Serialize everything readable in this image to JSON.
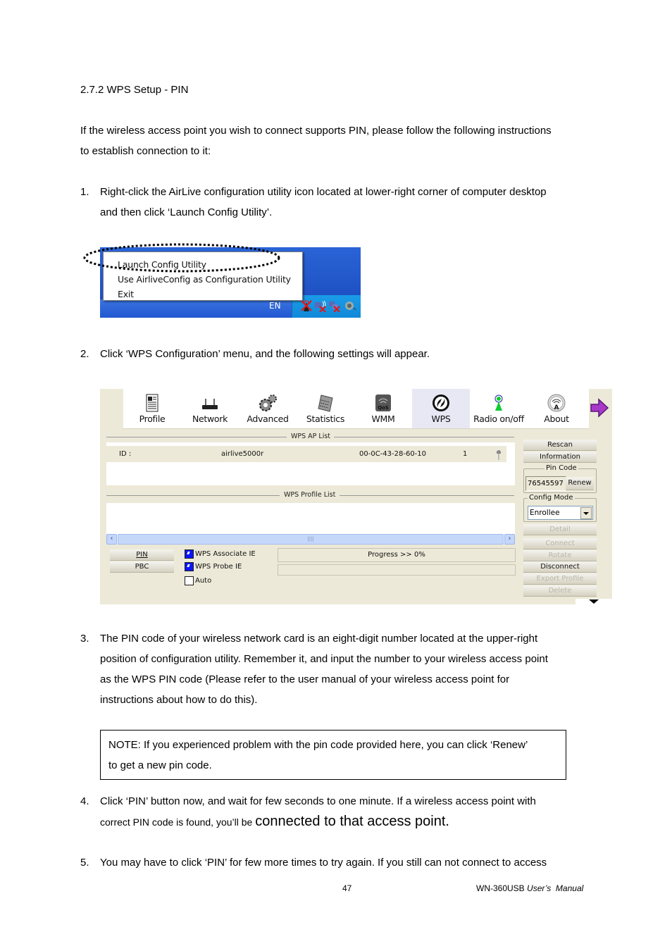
{
  "section_title": "2.7.2 WPS Setup - PIN",
  "intro": {
    "line1": "If the wireless access point you wish to connect supports PIN, please follow the following instructions",
    "line2": "to establish connection to it:"
  },
  "steps": [
    {
      "num": "1.",
      "lines": [
        "Right-click the AirLive configuration utility icon located at lower-right corner of computer desktop",
        "and then click ‘Launch Config Utility’."
      ]
    },
    {
      "num": "2.",
      "lines": [
        "Click ‘WPS Configuration’ menu, and the following settings will appear."
      ]
    },
    {
      "num": "3.",
      "lines": [
        "The PIN code of your wireless network card is an eight-digit number located at the upper-right",
        "position of configuration utility. Remember it, and input the number to your wireless access point",
        "as the WPS PIN code (Please refer to the user manual of your wireless access point for",
        "instructions about how to do this)."
      ]
    },
    {
      "num": "4.",
      "lines": [
        "Click ‘PIN’ button now, and wait for few seconds to one minute. If a wireless access point with",
        "correct PIN code is found, you’ll be "
      ],
      "large_tail": "connected to that access point."
    },
    {
      "num": "5.",
      "lines": [
        "You may have to click ‘PIN’ for few more times to try again. If you still can not connect to access"
      ]
    }
  ],
  "note": {
    "line1": "NOTE: If you experienced problem with the pin code provided here, you can click ‘Renew’",
    "line2": "to get a new pin code."
  },
  "tray_screenshot": {
    "menu_items": [
      "Launch Config Utility",
      "Use AirliveConfig as Configuration Utility",
      "Exit"
    ],
    "language": "EN",
    "tray_icons": [
      "airlive-disabled-icon",
      "wireless-disconnected-icon",
      "network-disconnected-icon",
      "volume-icon"
    ]
  },
  "utility_screenshot": {
    "toolbar": [
      {
        "label": "Profile",
        "icon": "profile-icon"
      },
      {
        "label": "Network",
        "icon": "network-icon"
      },
      {
        "label": "Advanced",
        "icon": "advanced-icon"
      },
      {
        "label": "Statistics",
        "icon": "statistics-icon"
      },
      {
        "label": "WMM",
        "icon": "wmm-qos-icon"
      },
      {
        "label": "WPS",
        "icon": "wps-icon",
        "active": true
      },
      {
        "label": "Radio on/off",
        "icon": "radio-icon"
      },
      {
        "label": "About",
        "icon": "about-icon"
      }
    ],
    "ap_list_title": "WPS AP List",
    "ap_row": {
      "id_label": "ID :",
      "ssid": "airlive5000r",
      "bssid": "00-0C-43-28-60-10",
      "channel": "1"
    },
    "profile_list_title": "WPS Profile List",
    "pin_button": "PIN",
    "pbc_button": "PBC",
    "checkboxes": [
      {
        "label": "WPS Associate IE",
        "checked": true
      },
      {
        "label": "WPS Probe IE",
        "checked": true
      },
      {
        "label": "Auto",
        "checked": false
      }
    ],
    "progress_text": "Progress >> 0%",
    "progress_value": 0,
    "side_buttons": {
      "rescan": "Rescan",
      "information": "Information",
      "pin_code_legend": "Pin Code",
      "pin_code_value": "76545597",
      "renew": "Renew",
      "config_mode_legend": "Config Mode",
      "config_mode_value": "Enrollee",
      "detail": "Detail",
      "connect": "Connect",
      "rotate": "Rotate",
      "disconnect": "Disconnect",
      "export_profile": "Export Profile",
      "delete": "Delete"
    }
  },
  "footer": {
    "page_number": "47",
    "model": "WN-360USB",
    "manual": "User’s  Manual"
  },
  "colors": {
    "xp_face": "#ece9d8",
    "taskbar_blue": "#2257cf",
    "tray_blue": "#118ad8",
    "checkbox_blue": "#0a14ff"
  }
}
